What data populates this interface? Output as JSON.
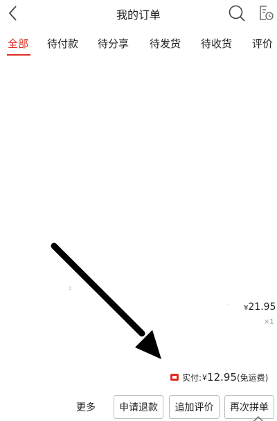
{
  "header": {
    "title": "我的订单",
    "back_icon": "chevron-left-icon",
    "search_icon": "search-icon",
    "list_icon": "order-list-icon"
  },
  "tabs": [
    {
      "label": "全部",
      "active": true
    },
    {
      "label": "待付款",
      "active": false
    },
    {
      "label": "待分享",
      "active": false
    },
    {
      "label": "待发货",
      "active": false
    },
    {
      "label": "待收货",
      "active": false
    },
    {
      "label": "评价",
      "active": false
    }
  ],
  "order": {
    "unit_price_symbol": "¥",
    "unit_price": "21.95",
    "quantity": "×1",
    "paid_label": "实付:",
    "paid_currency": "¥",
    "paid_amount": "12.95",
    "paid_note": "(免运费)"
  },
  "actions": {
    "more": "更多",
    "refund": "申请退款",
    "review": "追加评价",
    "rebuy": "再次拼单"
  },
  "colors": {
    "accent": "#e02e24",
    "text": "#222222",
    "muted": "#999999"
  }
}
